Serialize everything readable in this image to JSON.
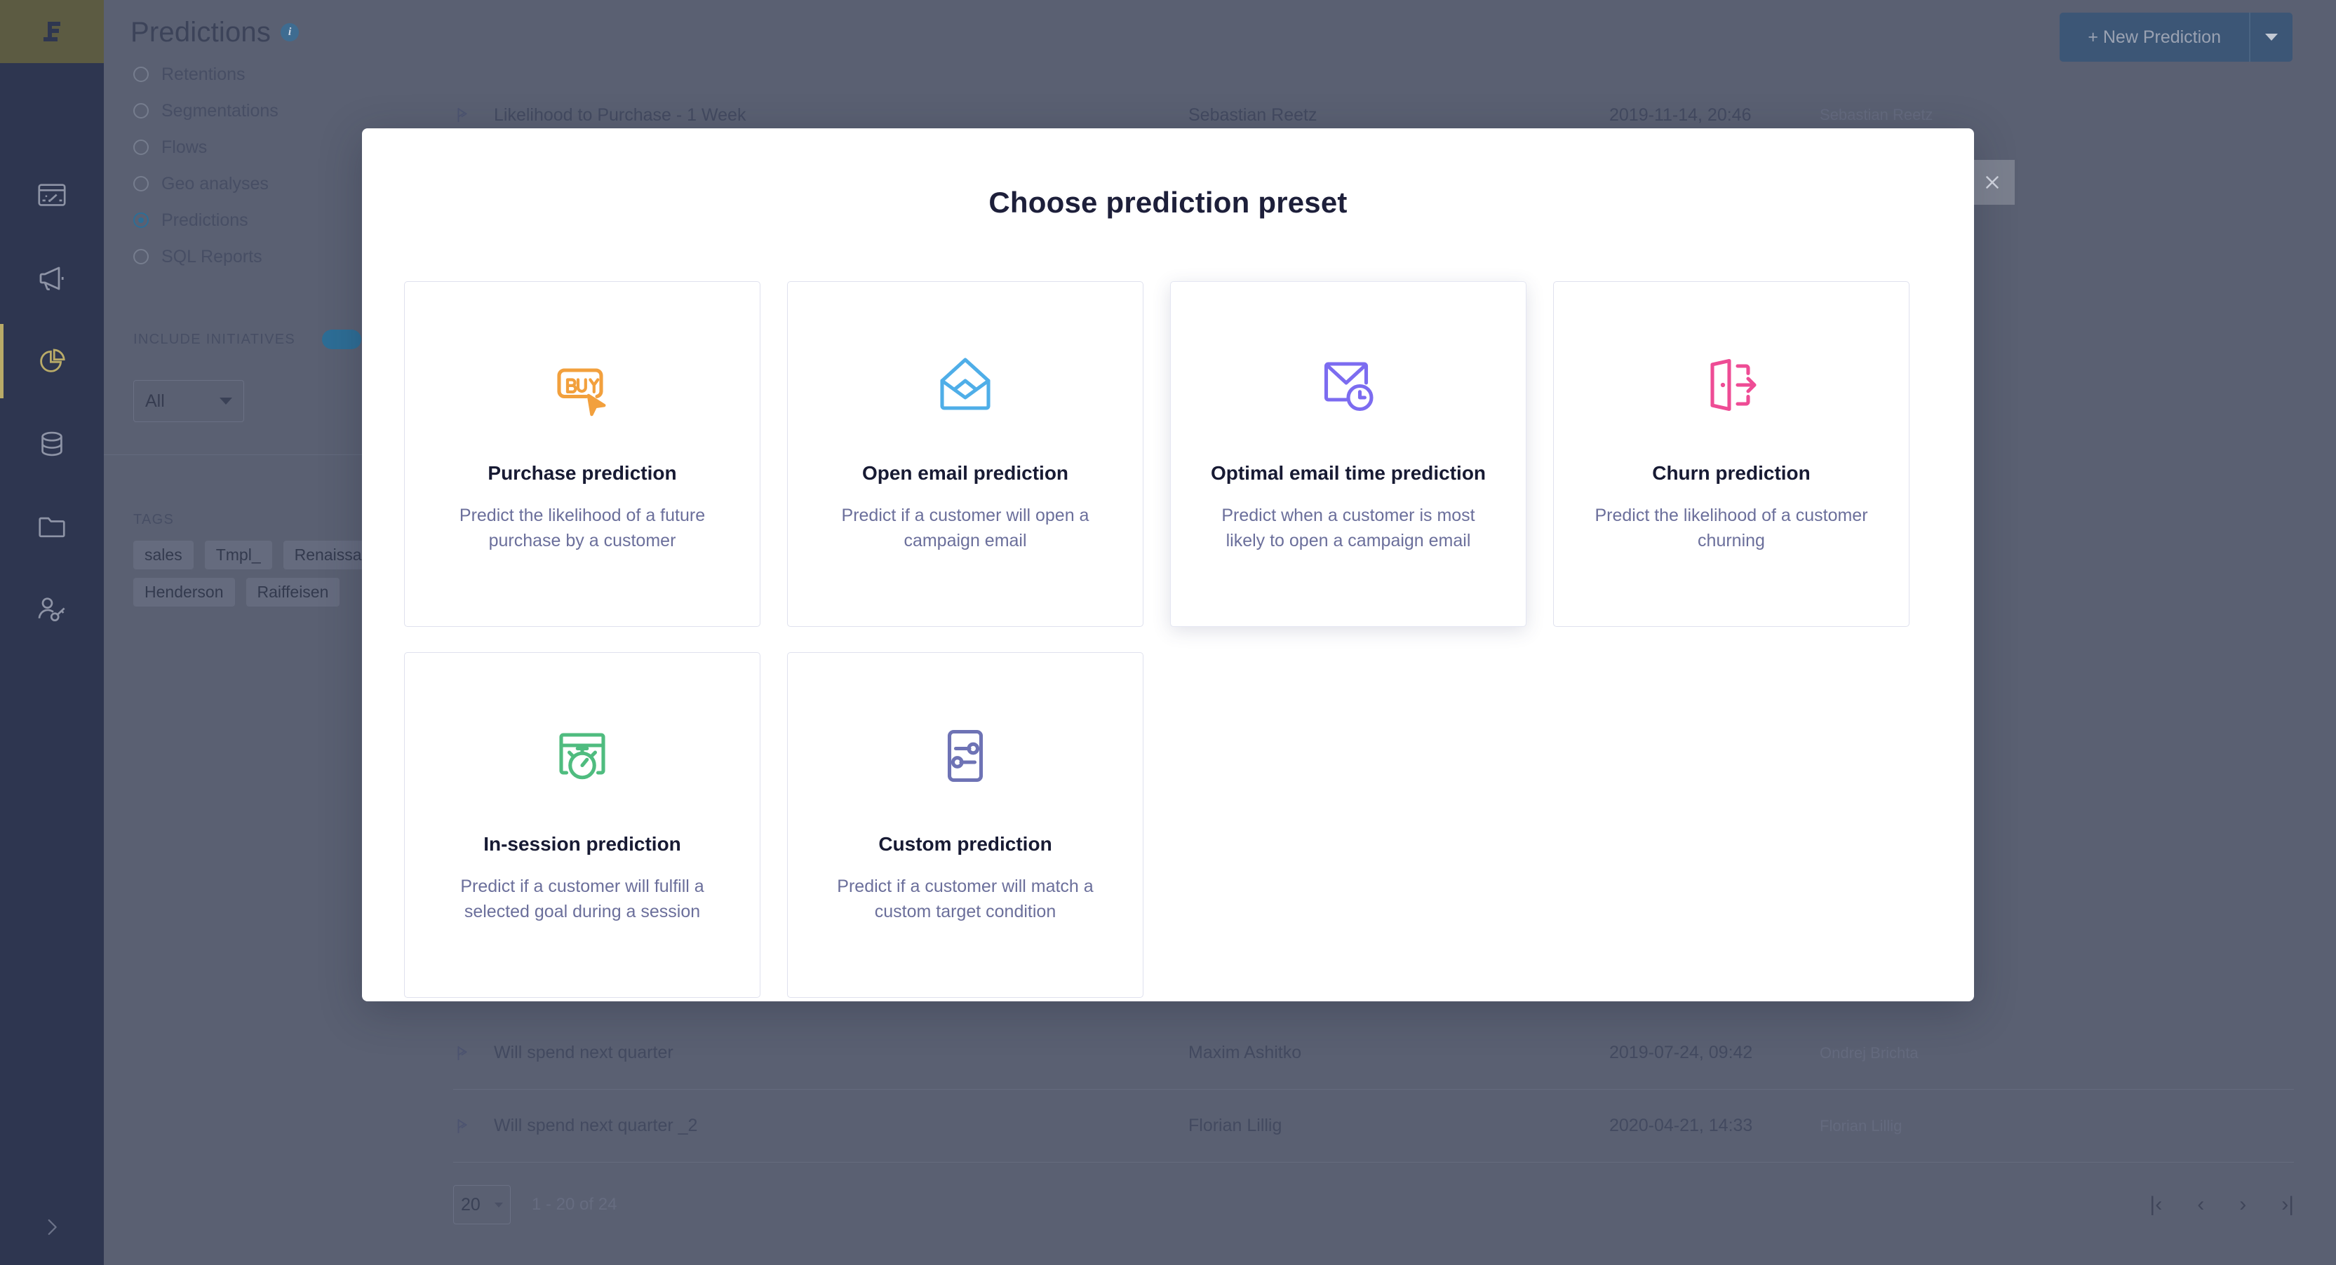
{
  "app": {
    "logo_icon": "brand-logo-icon",
    "rail_icons": [
      {
        "name": "dashboard-icon",
        "active": false
      },
      {
        "name": "campaigns-megaphone-icon",
        "active": false
      },
      {
        "name": "analytics-piechart-icon",
        "active": true
      },
      {
        "name": "database-icon",
        "active": false
      },
      {
        "name": "folder-icon",
        "active": false
      },
      {
        "name": "customer-identify-icon",
        "active": false
      }
    ],
    "expand_sidebar_icon": "chevron-right-icon"
  },
  "header": {
    "title": "Predictions",
    "info_icon": "info-icon",
    "new_prediction_label": "+ New Prediction",
    "new_prediction_caret_icon": "chevron-down-icon"
  },
  "nav": {
    "items": [
      {
        "label": "Retentions",
        "selected": false
      },
      {
        "label": "Segmentations",
        "selected": false
      },
      {
        "label": "Flows",
        "selected": false
      },
      {
        "label": "Geo analyses",
        "selected": false
      },
      {
        "label": "Predictions",
        "selected": true
      },
      {
        "label": "SQL Reports",
        "selected": false
      }
    ],
    "include_initiatives_label": "INCLUDE INITIATIVES",
    "initiatives_toggle_on": true,
    "filter_value": "All",
    "filter_caret_icon": "chevron-down-icon",
    "tags_label": "TAGS",
    "tags": [
      "sales",
      "Tmpl_",
      "Renaissance",
      "Henderson",
      "Raiffeisen"
    ]
  },
  "table": {
    "row_icon": "prediction-flag-icon",
    "rows": [
      {
        "name": "Likelihood to Purchase - 1 Week",
        "owner": "Sebastian Reetz",
        "date": "2019-11-14, 20:46",
        "editor": "Sebastian Reetz"
      },
      {
        "name": "Will spend next quarter",
        "owner": "Maxim Ashitko",
        "date": "2019-07-24, 09:42",
        "editor": "Ondrej Brichta"
      },
      {
        "name": "Will spend next quarter _2",
        "owner": "Florian Lillig",
        "date": "2020-04-21, 14:33",
        "editor": "Florian Lillig"
      }
    ]
  },
  "footer": {
    "page_size": "20",
    "page_size_caret_icon": "chevron-down-icon",
    "range_label": "1 - 20 of 24",
    "pager": [
      {
        "icon": "first-page-icon",
        "glyph": "|‹"
      },
      {
        "icon": "prev-page-icon",
        "glyph": "‹"
      },
      {
        "icon": "next-page-icon",
        "glyph": "›"
      },
      {
        "icon": "last-page-icon",
        "glyph": "›|"
      }
    ]
  },
  "modal": {
    "title": "Choose prediction preset",
    "close_icon": "close-icon",
    "presets": [
      {
        "id": "purchase",
        "icon": "buy-tag-cursor-icon",
        "color": "#F2A03D",
        "title": "Purchase prediction",
        "description": "Predict the likelihood of a future purchase by a customer",
        "hovered": false
      },
      {
        "id": "open-email",
        "icon": "open-envelope-icon",
        "color": "#4FAEE8",
        "title": "Open email prediction",
        "description": "Predict if a customer will open a campaign email",
        "hovered": false
      },
      {
        "id": "optimal-email-time",
        "icon": "envelope-clock-icon",
        "color": "#7C6CF0",
        "title": "Optimal email time prediction",
        "description": "Predict when a customer is most likely to open a campaign email",
        "hovered": true
      },
      {
        "id": "churn",
        "icon": "door-exit-icon",
        "color": "#EE4C95",
        "title": "Churn prediction",
        "description": "Predict the likelihood of a customer churning",
        "hovered": false
      },
      {
        "id": "in-session",
        "icon": "browser-stopwatch-icon",
        "color": "#4FBC7F",
        "title": "In-session prediction",
        "description": "Predict if a customer will fulfill a selected goal during a session",
        "hovered": false
      },
      {
        "id": "custom",
        "icon": "sliders-panel-icon",
        "color": "#6E73B5",
        "title": "Custom prediction",
        "description": "Predict if a customer will match a custom target condition",
        "hovered": false
      }
    ]
  }
}
